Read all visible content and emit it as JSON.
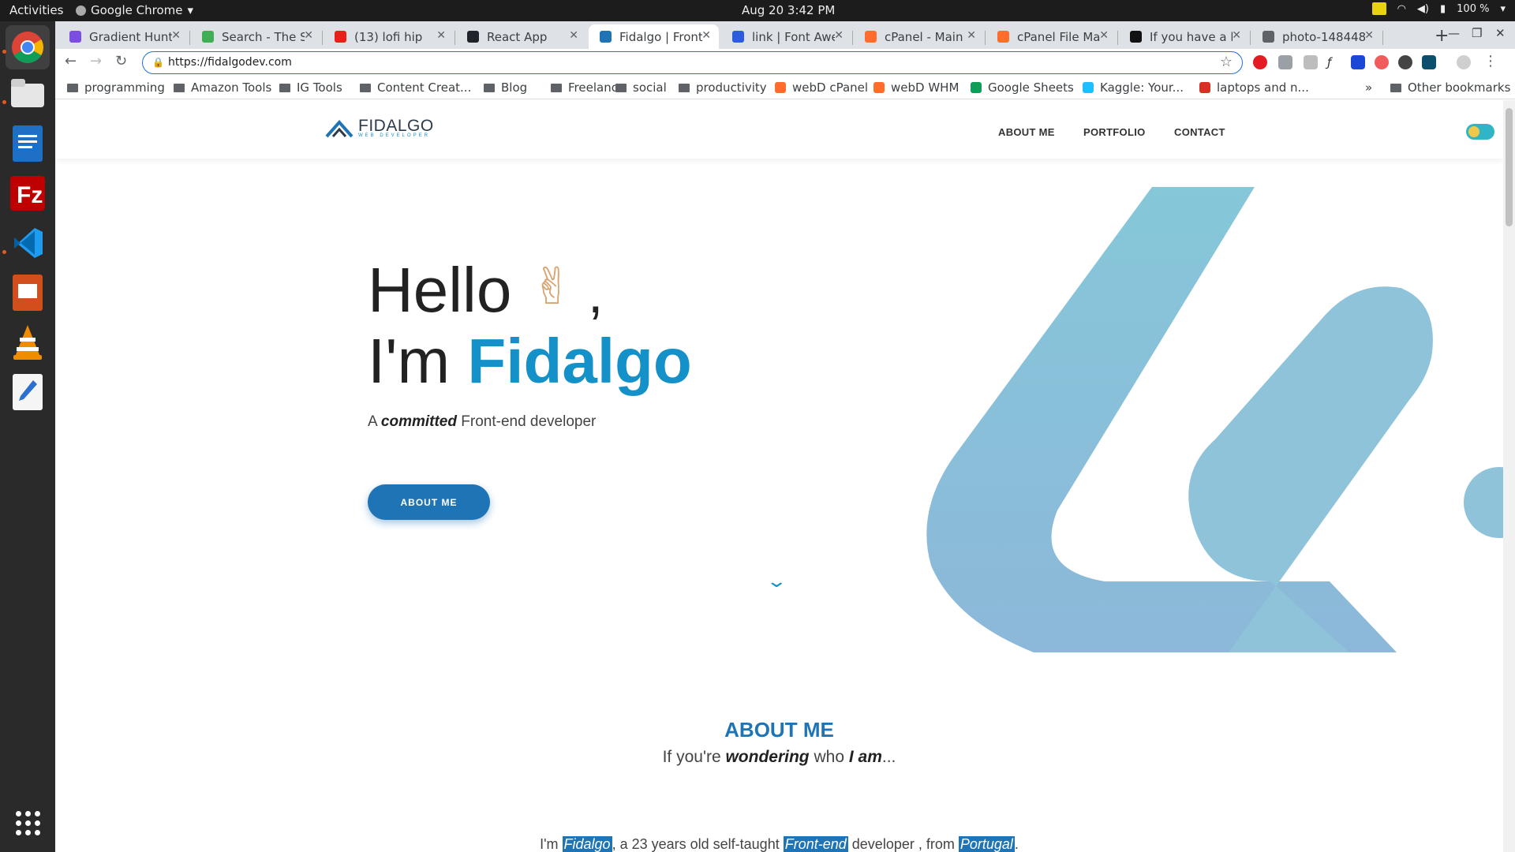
{
  "system": {
    "activities": "Activities",
    "app_menu": "Google Chrome",
    "clock": "Aug 20  3:42 PM",
    "battery": "100 %"
  },
  "tabs": [
    {
      "title": "Gradient Hunt",
      "color": "#7b4de0"
    },
    {
      "title": "Search - The So",
      "color": "#3fae54"
    },
    {
      "title": "(13) lofi hip",
      "color": "#e62117"
    },
    {
      "title": "React App",
      "color": "#20232a"
    },
    {
      "title": "Fidalgo | Front",
      "color": "#1f74b6"
    },
    {
      "title": "link | Font Awe",
      "color": "#2a5cdb"
    },
    {
      "title": "cPanel - Main",
      "color": "#ff6c2c"
    },
    {
      "title": "cPanel File Ma",
      "color": "#ff6c2c"
    },
    {
      "title": "If you have a li",
      "color": "#111111"
    },
    {
      "title": "photo-148448",
      "color": "#5f6368"
    }
  ],
  "address": {
    "url": "https://fidalgodev.com"
  },
  "bookmarks": [
    {
      "label": "programming",
      "kind": "folder"
    },
    {
      "label": "Amazon Tools",
      "kind": "folder"
    },
    {
      "label": "IG Tools",
      "kind": "folder"
    },
    {
      "label": "Content Creat...",
      "kind": "folder"
    },
    {
      "label": "Blog",
      "kind": "folder"
    },
    {
      "label": "Freelance",
      "kind": "folder"
    },
    {
      "label": "social",
      "kind": "folder"
    },
    {
      "label": "productivity",
      "kind": "folder"
    },
    {
      "label": "webD cPanel",
      "kind": "link"
    },
    {
      "label": "webD WHM",
      "kind": "link"
    },
    {
      "label": "Google Sheets",
      "kind": "link"
    },
    {
      "label": "Kaggle: Your...",
      "kind": "link"
    },
    {
      "label": "laptops and n...",
      "kind": "link"
    }
  ],
  "bookmarks_overflow": "»",
  "other_bookmarks": "Other bookmarks",
  "site": {
    "logo_name": "FIDALGO",
    "logo_sub": "WEB DEVELOPER",
    "nav": [
      "ABOUT ME",
      "PORTFOLIO",
      "CONTACT"
    ],
    "hello": "Hello",
    "comma": ",",
    "peace_emoji": "✌",
    "im": "I'm",
    "name": "Fidalgo",
    "tagline_a": "A",
    "tagline_bold": "committed",
    "tagline_rest": "Front-end developer",
    "cta": "ABOUT ME",
    "section_title": "ABOUT ME",
    "section_sub_1": "If you're",
    "section_sub_bold1": "wondering",
    "section_sub_2": "who",
    "section_sub_bold2": "I am",
    "section_sub_3": "...",
    "about_1": "I'm",
    "about_hl1": "Fidalgo",
    "about_2": ", a 23 years old self-taught",
    "about_hl2": "Front-end",
    "about_3": "developer , from",
    "about_hl3": "Portugal",
    "about_4": ".",
    "accent_color": "#1f74b6",
    "art_color": "#8ec3da"
  }
}
